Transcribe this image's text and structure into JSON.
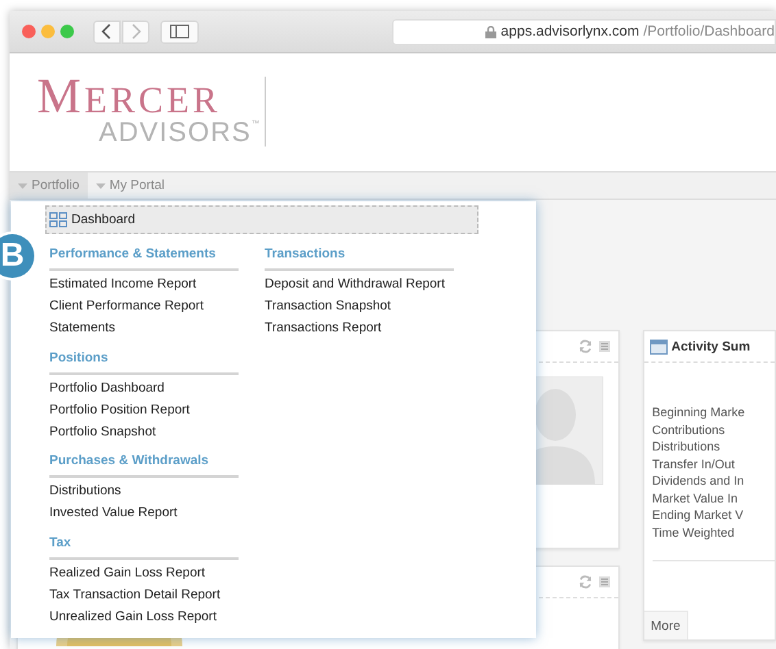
{
  "browser": {
    "url_host": "apps.advisorlynx.com",
    "url_path": "/Portfolio/Dashboard"
  },
  "logo": {
    "name": "MERCER",
    "subtitle": "ADVISORS",
    "trademark": "™"
  },
  "nav": [
    {
      "label": "Portfolio",
      "selected": true
    },
    {
      "label": "My Portal",
      "selected": false
    }
  ],
  "menu": {
    "dashboard": {
      "label": "Dashboard",
      "selected": true
    },
    "badge": "B",
    "columns": [
      [
        {
          "title": "Performance & Statements",
          "items": [
            "Estimated Income Report",
            "Client Performance Report",
            "Statements"
          ]
        },
        {
          "title": "Positions",
          "items": [
            "Portfolio Dashboard",
            "Portfolio Position Report",
            "Portfolio Snapshot"
          ]
        },
        {
          "title": "Purchases & Withdrawals",
          "items": [
            "Distributions",
            "Invested Value Report"
          ]
        },
        {
          "title": "Tax",
          "items": [
            "Realized Gain Loss Report",
            "Tax Transaction Detail Report",
            "Unrealized Gain Loss Report"
          ]
        }
      ],
      [
        {
          "title": "Transactions",
          "items": [
            "Deposit and Withdrawal Report",
            "Transaction Snapshot",
            "Transactions Report"
          ]
        }
      ]
    ]
  },
  "activity": {
    "title": "Activity Sum",
    "rows": [
      "Beginning Marke",
      "Contributions",
      "Distributions",
      "Transfer In/Out",
      "Dividends and In",
      "Market Value In",
      "Ending Market V",
      "Time Weighted"
    ],
    "more": "More"
  }
}
